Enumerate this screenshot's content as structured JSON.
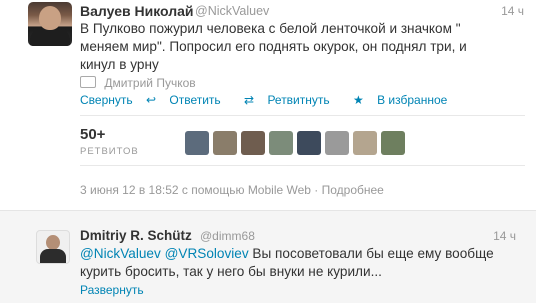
{
  "main_tweet": {
    "name": "Валуев Николай",
    "handle": "@NickValuev",
    "time": "14 ч",
    "text_line1": "В Пулково пожурил человека с белой ленточкой и значком \"",
    "text_line2": "меняем мир\". Попросил его поднять окурок, он поднял три, и",
    "text_line3": "кинул в урну",
    "retweeted_by": "Дмитрий Пучков",
    "actions": {
      "collapse": "Свернуть",
      "reply": "Ответить",
      "retweet": "Ретвитнуть",
      "favorite": "В избранное"
    },
    "retweet_count": "50+",
    "retweet_label": "РЕТВИТОВ",
    "avatar_colors": [
      "#5c6b7c",
      "#8a7d6a",
      "#6f5d4f",
      "#7c8c7a",
      "#3d4a5c",
      "#9a9a9a",
      "#b4a58f",
      "#6e7f5f"
    ],
    "meta": {
      "date": "3 июня 12 в 18:52 с помощью Mobile Web",
      "separator": " · ",
      "details": "Подробнее"
    }
  },
  "reply_tweet": {
    "name": "Dmitriy R. Schütz",
    "handle": "@dimm68",
    "time": "14 ч",
    "mention1": "@NickValuev",
    "mention2": "@VRSoloviev",
    "text_rest": " Вы посоветовали бы еще ему вообще",
    "text_line2": "курить бросить, так у него бы внуки не курили...",
    "expand": "Развернуть"
  }
}
